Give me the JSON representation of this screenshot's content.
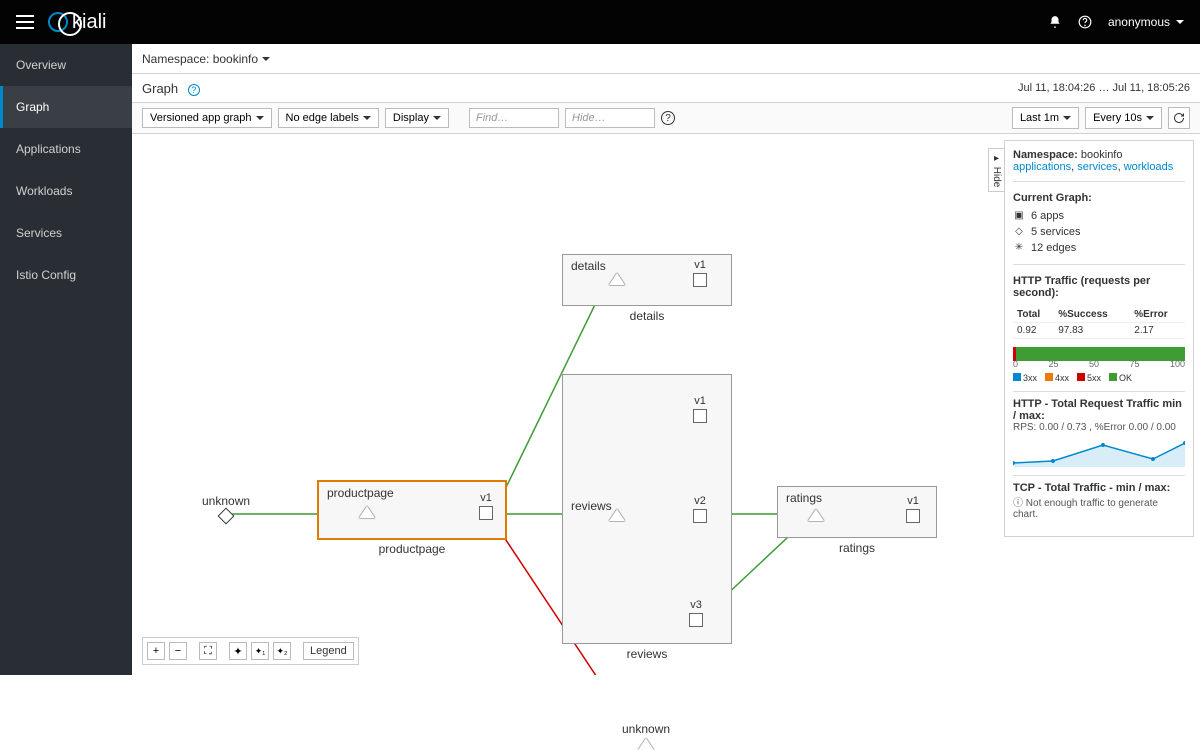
{
  "brand": "kiali",
  "user": "anonymous",
  "sidebar": {
    "items": [
      {
        "label": "Overview"
      },
      {
        "label": "Graph"
      },
      {
        "label": "Applications"
      },
      {
        "label": "Workloads"
      },
      {
        "label": "Services"
      },
      {
        "label": "Istio Config"
      }
    ]
  },
  "ns_label": "Namespace: bookinfo",
  "page_title": "Graph",
  "time_range": "Jul 11, 18:04:26 … Jul 11, 18:05:26",
  "toolbar": {
    "graph_type": "Versioned app graph",
    "edge_labels": "No edge labels",
    "display": "Display",
    "find_ph": "Find…",
    "hide_ph": "Hide…",
    "last": "Last 1m",
    "every": "Every 10s"
  },
  "panel": {
    "ns_title": "Namespace:",
    "ns_value": "bookinfo",
    "links": {
      "a": "applications",
      "b": "services",
      "c": "workloads"
    },
    "graph_hdr": "Current Graph:",
    "apps": "6 apps",
    "services": "5 services",
    "edges": "12 edges",
    "http_hdr": "HTTP Traffic (requests per second):",
    "cols": {
      "total": "Total",
      "succ": "%Success",
      "err": "%Error"
    },
    "row": {
      "total": "0.92",
      "succ": "97.83",
      "err": "2.17"
    },
    "scale": {
      "s0": "0",
      "s25": "25",
      "s50": "50",
      "s75": "75",
      "s100": "100"
    },
    "legend": {
      "l3": "3xx",
      "l4": "4xx",
      "l5": "5xx",
      "ok": "OK"
    },
    "http_minmax_hdr": "HTTP - Total Request Traffic min / max:",
    "http_minmax_val": "RPS: 0.00 / 0.73 , %Error 0.00 / 0.00",
    "tcp_hdr": "TCP - Total Traffic - min / max:",
    "tcp_msg": "Not enough traffic to generate chart."
  },
  "graph": {
    "unknown": "unknown",
    "productpage": "productpage",
    "details": "details",
    "reviews": "reviews",
    "ratings": "ratings",
    "v1": "v1",
    "v2": "v2",
    "v3": "v3",
    "unknown2": "unknown"
  },
  "legend_btn": "Legend",
  "hide_btn": "Hide",
  "pct": "%",
  "chart_data": {
    "type": "bar",
    "categories": [
      "3xx",
      "4xx",
      "5xx",
      "OK"
    ],
    "values": [
      0,
      0,
      2.17,
      97.83
    ],
    "title": "HTTP Traffic (requests per second)",
    "xlabel": "",
    "ylabel": "%",
    "ylim": [
      0,
      100
    ]
  }
}
